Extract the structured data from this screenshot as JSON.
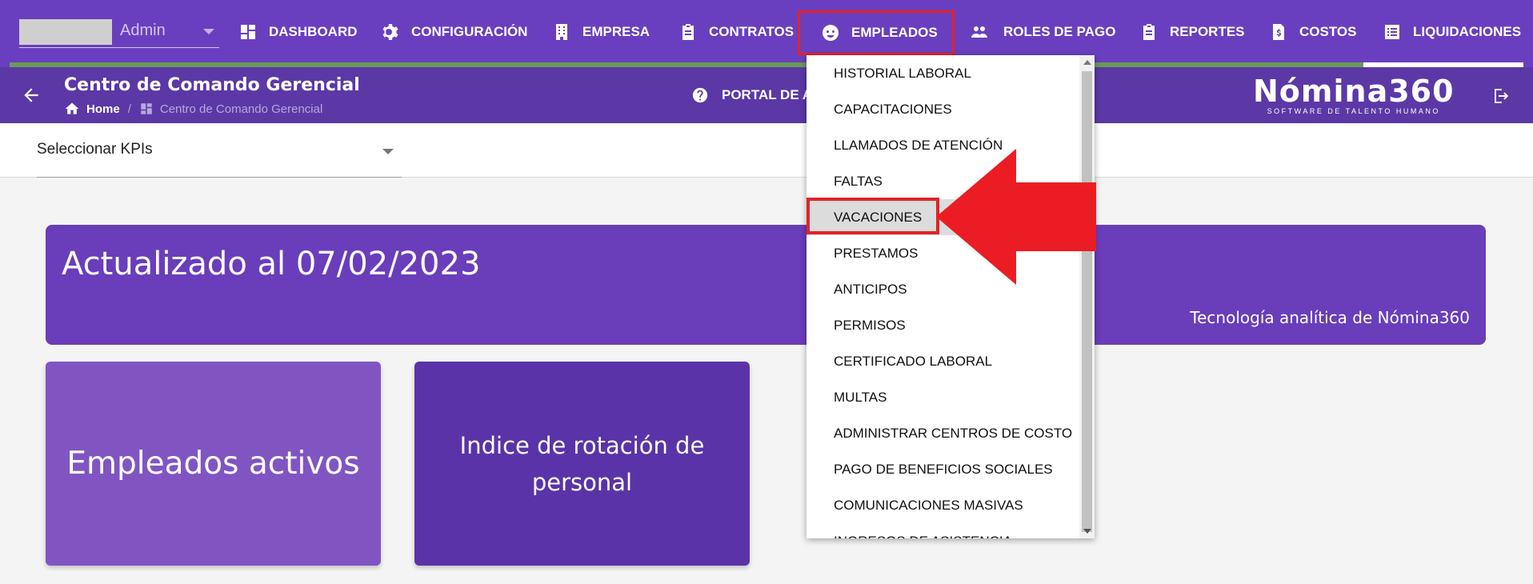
{
  "user": {
    "name": "Admin"
  },
  "nav": {
    "dashboard": "DASHBOARD",
    "configuracion": "CONFIGURACIÓN",
    "empresa": "EMPRESA",
    "contratos": "CONTRATOS",
    "empleados": "EMPLEADOS",
    "roles_de_pago": "ROLES DE PAGO",
    "reportes": "REPORTES",
    "costos": "COSTOS",
    "liquidaciones": "LIQUIDACIONES"
  },
  "header": {
    "title": "Centro de Comando Gerencial",
    "breadcrumb_home": "Home",
    "breadcrumb_current": "Centro de Comando Gerencial",
    "portal_label": "PORTAL DE A",
    "brand_name": "Nómina360",
    "brand_tagline": "SOFTWARE DE TALENTO HUMANO"
  },
  "filter": {
    "kpi_select_value": "Seleccionar KPIs"
  },
  "banner": {
    "title": "Actualizado al 07/02/2023",
    "subtitle": "Tecnología analítica de Nómina360"
  },
  "cards": [
    {
      "label": "Empleados activos"
    },
    {
      "label": "Indice de rotación de personal"
    }
  ],
  "empleados_menu": {
    "items": [
      "HISTORIAL LABORAL",
      "CAPACITACIONES",
      "LLAMADOS DE ATENCIÓN",
      "FALTAS",
      "VACACIONES",
      "PRESTAMOS",
      "ANTICIPOS",
      "PERMISOS",
      "CERTIFICADO LABORAL",
      "MULTAS",
      "ADMINISTRAR CENTROS DE COSTO",
      "PAGO DE BENEFICIOS SOCIALES",
      "COMUNICACIONES MASIVAS",
      "INGRESOS DE ASISTENCIA"
    ],
    "selected": "VACACIONES"
  },
  "colors": {
    "topbar": "#6a3fbf",
    "subbar": "#5b38a6",
    "banner": "#6a3dbb",
    "card1": "#8055c2",
    "card2": "#5b33a8",
    "highlight_border": "#e32228"
  },
  "icons": {
    "dashboard": "grid-icon",
    "configuracion": "gear-icon",
    "empresa": "building-icon",
    "contratos": "clipboard-icon",
    "empleados": "face-icon",
    "roles_de_pago": "people-icon",
    "reportes": "clipboard-icon",
    "costos": "invoice-icon",
    "liquidaciones": "list-icon",
    "back": "arrow-left-icon",
    "home": "home-icon",
    "portal": "help-circle-icon",
    "logout": "logout-icon"
  }
}
